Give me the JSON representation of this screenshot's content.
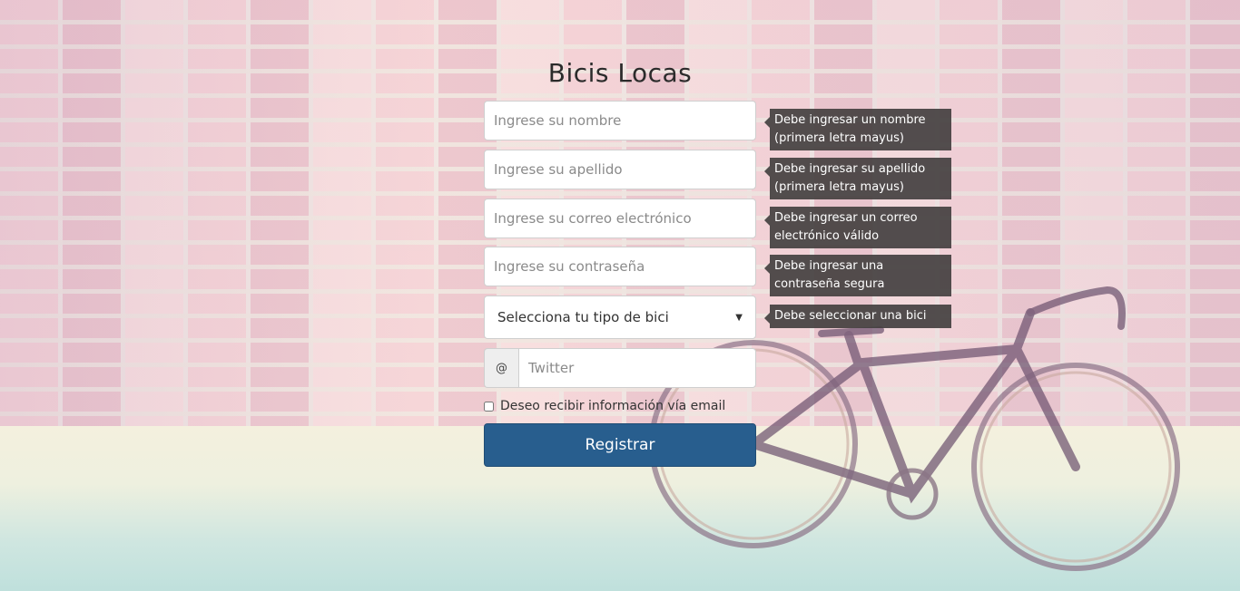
{
  "page": {
    "title": "Bicis Locas"
  },
  "form": {
    "nombre_placeholder": "Ingrese su nombre",
    "apellido_placeholder": "Ingrese su apellido",
    "correo_placeholder": "Ingrese su correo electrónico",
    "contrasena_placeholder": "Ingrese su contraseña",
    "bike_select": {
      "selected": "Selecciona tu tipo de bici"
    },
    "twitter_addon": "@",
    "twitter_placeholder": "Twitter",
    "newsletter_label": "Deseo recibir información vía email",
    "newsletter_checked": false,
    "submit_label": "Registrar"
  },
  "tooltips": {
    "nombre": [
      "Debe ingresar un nombre",
      "(primera letra mayus)"
    ],
    "apellido": [
      "Debe ingresar su apellido",
      "(primera letra mayus)"
    ],
    "correo": [
      "Debe ingresar un correo",
      "electrónico válido"
    ],
    "contrasena": [
      "Debe ingresar una",
      "contraseña segura"
    ],
    "bici": [
      "Debe seleccionar una bici"
    ]
  },
  "colors": {
    "button_bg": "#285e8e",
    "tooltip_bg": "#444040",
    "title_color": "#2b2b2b"
  },
  "icons": {
    "select_arrow": "caret-down-icon"
  }
}
